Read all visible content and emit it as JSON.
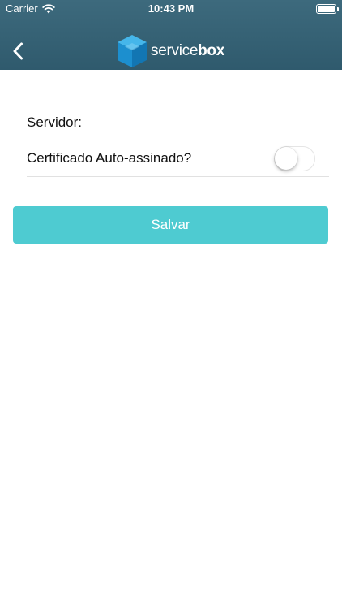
{
  "status_bar": {
    "carrier": "Carrier",
    "time": "10:43 PM",
    "battery_level": 1.0
  },
  "nav": {
    "back_icon": "chevron-left-icon",
    "logo": {
      "icon": "cube-logo-icon",
      "text_regular": "service",
      "text_bold": "box"
    }
  },
  "form": {
    "server_label": "Servidor:",
    "server_value": "",
    "self_signed_label": "Certificado Auto-assinado?",
    "self_signed_enabled": false
  },
  "save_button": {
    "label": "Salvar"
  },
  "colors": {
    "header": "#386577",
    "accent": "#4ecbd1",
    "logo_cube": "#1e9bd8"
  }
}
